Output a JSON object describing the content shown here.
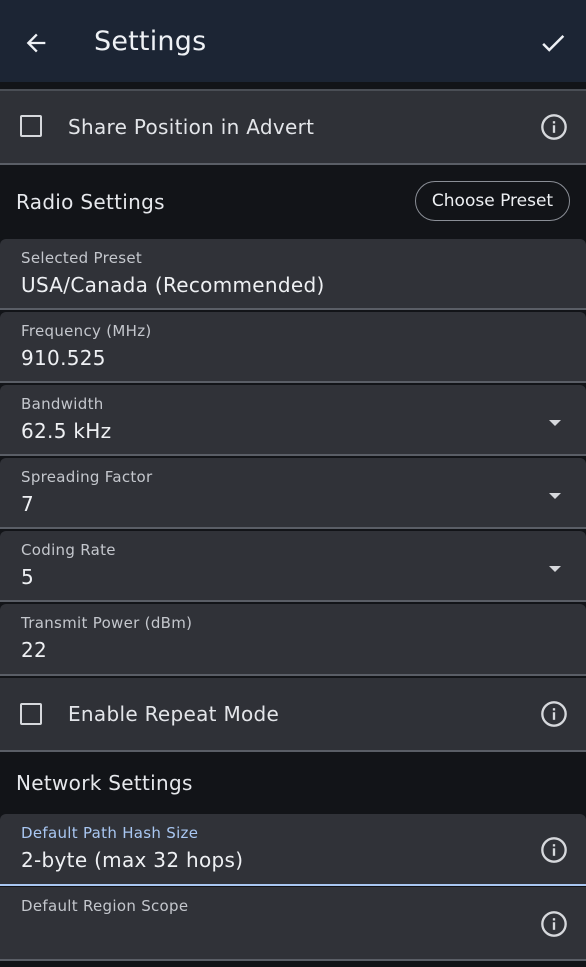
{
  "appbar": {
    "title": "Settings",
    "back_icon": "arrow-left-icon",
    "confirm_icon": "check-icon"
  },
  "share_position": {
    "label": "Share Position in Advert",
    "checked": false
  },
  "radio_settings": {
    "title": "Radio Settings",
    "choose_preset_label": "Choose Preset",
    "fields": {
      "selected_preset": {
        "label": "Selected Preset",
        "value": "USA/Canada (Recommended)"
      },
      "frequency": {
        "label": "Frequency (MHz)",
        "value": "910.525"
      },
      "bandwidth": {
        "label": "Bandwidth",
        "value": "62.5 kHz"
      },
      "spreading_factor": {
        "label": "Spreading Factor",
        "value": "7"
      },
      "coding_rate": {
        "label": "Coding Rate",
        "value": "5"
      },
      "transmit_power": {
        "label": "Transmit Power (dBm)",
        "value": "22"
      }
    }
  },
  "repeat_mode": {
    "label": "Enable Repeat Mode",
    "checked": false
  },
  "network_settings": {
    "title": "Network Settings",
    "fields": {
      "path_hash_size": {
        "label": "Default Path Hash Size",
        "value": "2-byte (max 32 hops)"
      },
      "region_scope": {
        "label": "Default Region Scope",
        "value": ""
      }
    }
  },
  "colors": {
    "appbar": "#1c2534",
    "accent": "#a9c7f2",
    "row_bg": "#2f3137",
    "section_bg": "#121418"
  }
}
